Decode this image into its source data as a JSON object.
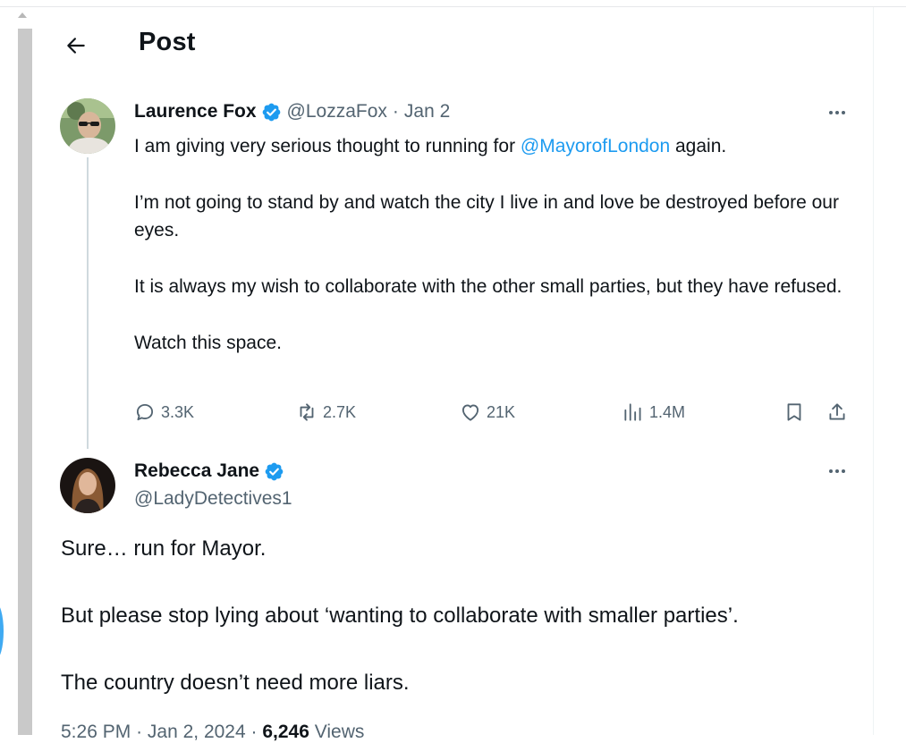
{
  "header": {
    "title": "Post"
  },
  "tweet": {
    "author_name": "Laurence Fox",
    "handle": "@LozzaFox",
    "separator": "·",
    "date": "Jan 2",
    "text_prefix": "I am giving very serious thought to running for ",
    "mention": "@MayorofLondon",
    "text_suffix": " again.",
    "paragraphs": [
      "I’m not going to stand by and watch the city I live in and love be destroyed before our eyes.",
      "It is always my wish to collaborate with the other small parties, but they have refused.",
      "Watch this space."
    ],
    "stats": {
      "replies": "3.3K",
      "reposts": "2.7K",
      "likes": "21K",
      "views": "1.4M"
    }
  },
  "reply": {
    "author_name": "Rebecca Jane",
    "handle": "@LadyDetectives1",
    "paragraphs": [
      "Sure… run for Mayor.",
      "But please stop lying about ‘wanting to collaborate with smaller parties’.",
      "The country doesn’t need more liars."
    ],
    "time": "5:26 PM",
    "date": "Jan 2, 2024",
    "separator": "·",
    "views_count": "6,246",
    "views_label": "Views"
  },
  "icons": {
    "back": "arrow-left-icon",
    "verified": "verified-badge-icon",
    "more": "more-dots-icon",
    "reply": "comment-icon",
    "repost": "repost-icon",
    "like": "heart-icon",
    "views": "bar-chart-icon",
    "bookmark": "bookmark-icon",
    "share": "share-icon"
  },
  "colors": {
    "accent": "#1d9bf0",
    "text": "#0f1419",
    "secondary": "#536471"
  }
}
